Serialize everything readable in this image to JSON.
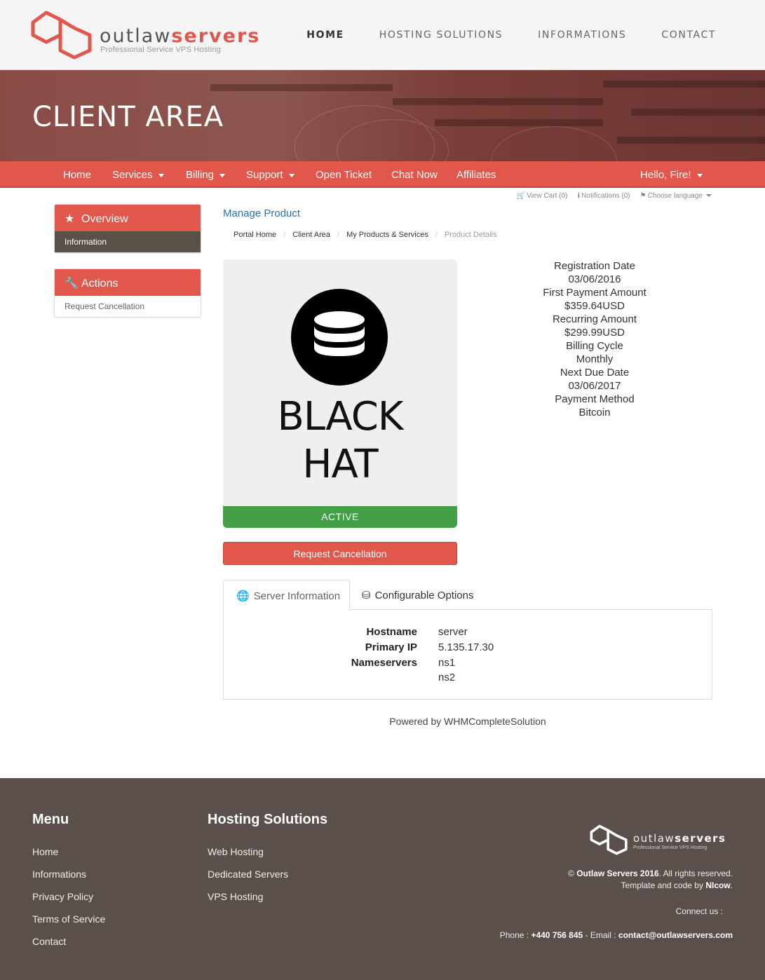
{
  "brand": {
    "name_light": "outlaw",
    "name_bold": "servers",
    "tagline": "Professional Service VPS Hosting"
  },
  "topnav": [
    {
      "label": "HOME",
      "active": true
    },
    {
      "label": "HOSTING SOLUTIONS",
      "active": false
    },
    {
      "label": "INFORMATIONS",
      "active": false
    },
    {
      "label": "CONTACT",
      "active": false
    }
  ],
  "banner": {
    "title": "CLIENT AREA"
  },
  "clientnav": {
    "home": "Home",
    "services": "Services",
    "billing": "Billing",
    "support": "Support",
    "open_ticket": "Open Ticket",
    "chat_now": "Chat Now",
    "affiliates": "Affiliates",
    "user": "Hello, Fire!"
  },
  "utility": {
    "cart": "View Cart (0)",
    "notifications": "Notifications (0)",
    "language": "Choose language"
  },
  "sidebar": {
    "overview": {
      "title": "Overview",
      "item": "Information"
    },
    "actions": {
      "title": "Actions",
      "item": "Request Cancellation"
    }
  },
  "main": {
    "title": "Manage Product",
    "breadcrumb": [
      "Portal Home",
      "Client Area",
      "My Products & Services",
      "Product Details"
    ],
    "product": {
      "line1": "BLACK",
      "line2": "HAT",
      "status": "ACTIVE"
    },
    "cancel_button": "Request Cancellation",
    "details": [
      {
        "label": "Registration Date",
        "value": "03/06/2016"
      },
      {
        "label": "First Payment Amount",
        "value": "$359.64USD"
      },
      {
        "label": "Recurring Amount",
        "value": "$299.99USD"
      },
      {
        "label": "Billing Cycle",
        "value": "Monthly"
      },
      {
        "label": "Next Due Date",
        "value": "03/06/2017"
      },
      {
        "label": "Payment Method",
        "value": "Bitcoin"
      }
    ],
    "tabs": {
      "server_info": "Server Information",
      "config_options": "Configurable Options"
    },
    "server": {
      "hostname_label": "Hostname",
      "hostname": "server",
      "ip_label": "Primary IP",
      "ip": "5.135.17.30",
      "ns_label": "Nameservers",
      "ns1": "ns1",
      "ns2": "ns2"
    },
    "powered": "Powered by WHMCompleteSolution"
  },
  "footer": {
    "menu_title": "Menu",
    "menu": [
      "Home",
      "Informations",
      "Privacy Policy",
      "Terms of Service",
      "Contact"
    ],
    "hosting_title": "Hosting Solutions",
    "hosting": [
      "Web Hosting",
      "Dedicated Servers",
      "VPS Hosting"
    ],
    "copyright_prefix": "©",
    "copyright_bold": "Outlaw Servers 2016",
    "copyright_rest": ". All rights reserved.",
    "template_prefix": "Template and code by",
    "template_author": "NIcow",
    "template_suffix": ".",
    "connect": "Connect us :",
    "phone_label": "Phone :",
    "phone": "+440 756 845",
    "email_label": "- Email :",
    "email": "contact@outlawservers.com"
  },
  "colors": {
    "accent": "#e2574c",
    "active": "#43a047",
    "footer": "#5b4f4b",
    "link": "#2a6fa8"
  }
}
